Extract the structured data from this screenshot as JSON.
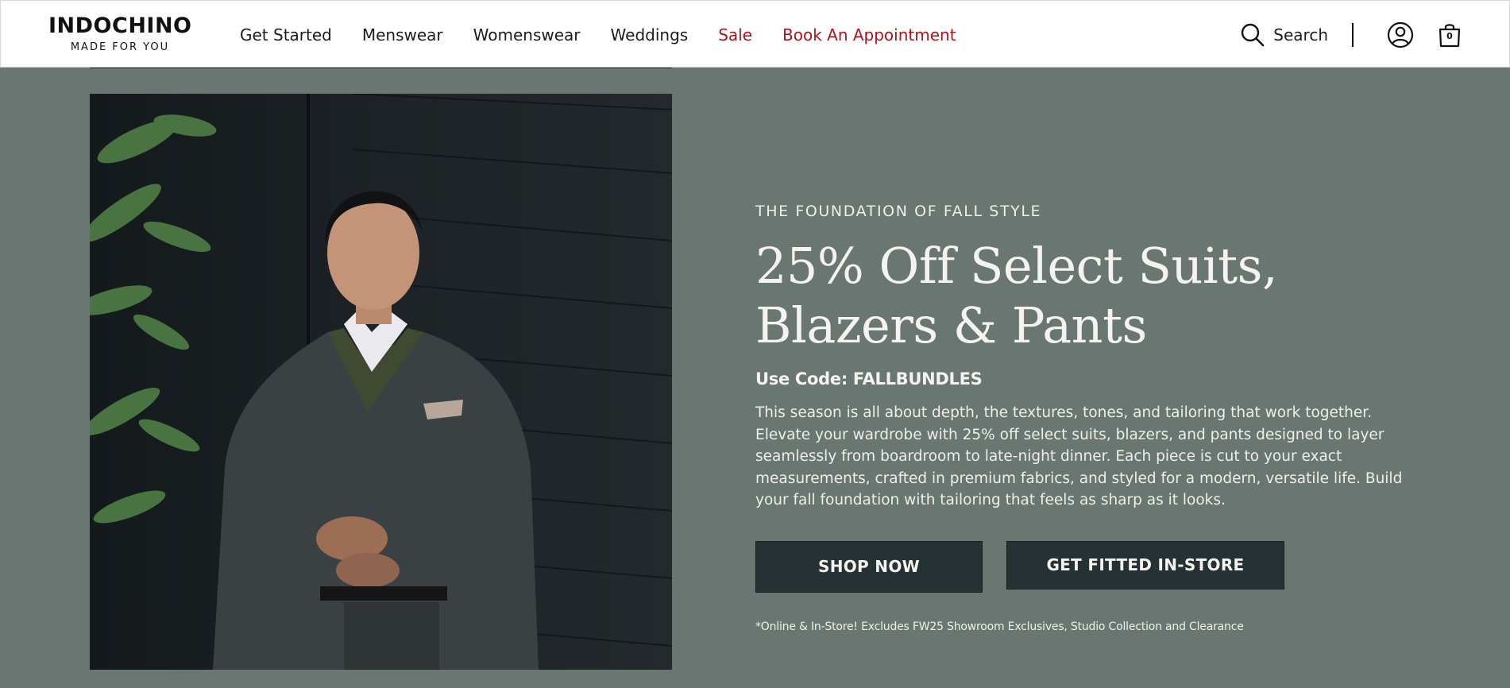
{
  "header": {
    "logo": {
      "name": "INDOCHINO",
      "tagline": "MADE FOR YOU"
    },
    "nav": [
      {
        "label": "Get Started",
        "color": "#1c1c1c"
      },
      {
        "label": "Menswear",
        "color": "#1c1c1c"
      },
      {
        "label": "Womenswear",
        "color": "#1c1c1c"
      },
      {
        "label": "Weddings",
        "color": "#1c1c1c"
      },
      {
        "label": "Sale",
        "color": "#b3121c"
      },
      {
        "label": "Book An Appointment",
        "color": "#b3121c"
      }
    ],
    "search_label": "Search",
    "cart_count": "0",
    "icons": {
      "search": "search-icon",
      "account": "account-icon",
      "cart": "shopping-bag-icon"
    }
  },
  "hero": {
    "eyebrow": "THE FOUNDATION OF FALL STYLE",
    "headline": "25% Off Select Suits, Blazers & Pants",
    "code": "Use Code: FALLBUNDLES",
    "body": "This season is all about depth, the textures, tones, and tailoring that work together. Elevate your wardrobe with 25% off select suits, blazers, and pants designed to layer seamlessly from boardroom to late-night dinner. Each piece is cut to your exact measurements, crafted in premium fabrics, and styled for a modern, versatile life. Build your fall foundation with tailoring that feels as sharp as it looks.",
    "buttons": {
      "shop_now": "SHOP NOW",
      "get_fitted": "GET FITTED IN-STORE"
    },
    "disclaimer": "*Online & In-Store! Excludes FW25 Showroom Exclusives, Studio Collection and Clearance"
  },
  "colors": {
    "background": "#6a7672",
    "button": "#263133",
    "accent_red": "#b3121c"
  }
}
